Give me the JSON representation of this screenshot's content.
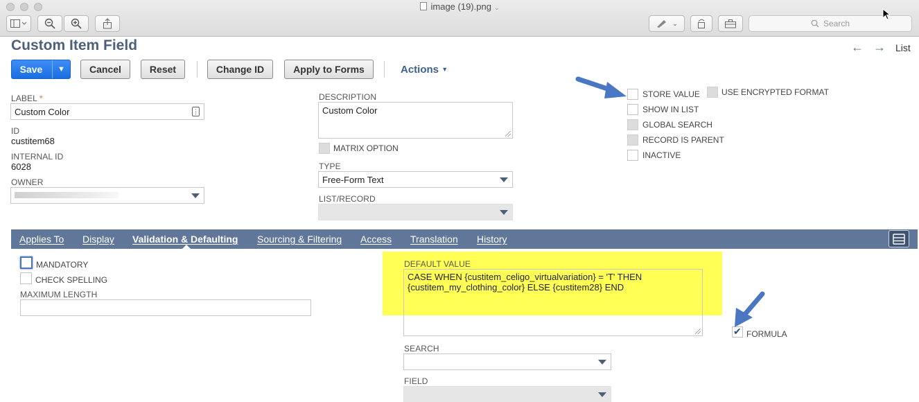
{
  "window": {
    "title": "image (19).png",
    "search_placeholder": "Search"
  },
  "page": {
    "title": "Custom Item Field",
    "nav": {
      "back_label": "←",
      "forward_label": "→",
      "list_label": "List"
    }
  },
  "buttons": {
    "save": "Save",
    "cancel": "Cancel",
    "reset": "Reset",
    "change_id": "Change ID",
    "apply_to_forms": "Apply to Forms",
    "actions": "Actions"
  },
  "fields": {
    "label": {
      "label": "LABEL",
      "required_mark": "*",
      "value": "Custom Color"
    },
    "id": {
      "label": "ID",
      "value": "custitem68"
    },
    "internal_id": {
      "label": "INTERNAL ID",
      "value": "6028"
    },
    "owner": {
      "label": "OWNER",
      "value": ""
    },
    "description": {
      "label": "DESCRIPTION",
      "value": "Custom Color"
    },
    "matrix_option": {
      "label": "MATRIX OPTION",
      "checked": false
    },
    "type": {
      "label": "TYPE",
      "value": "Free-Form Text"
    },
    "list_record": {
      "label": "LIST/RECORD",
      "value": ""
    }
  },
  "checkboxes_right": [
    {
      "label": "STORE VALUE",
      "checked": false
    },
    {
      "label": "USE ENCRYPTED FORMAT",
      "checked": false
    },
    {
      "label": "SHOW IN LIST",
      "checked": false
    },
    {
      "label": "GLOBAL SEARCH",
      "checked": false
    },
    {
      "label": "RECORD IS PARENT",
      "checked": false
    },
    {
      "label": "INACTIVE",
      "checked": false
    }
  ],
  "tabs": [
    {
      "label": "Applies To",
      "active": false
    },
    {
      "label": "Display",
      "active": false
    },
    {
      "label": "Validation & Defaulting",
      "active": true
    },
    {
      "label": "Sourcing & Filtering",
      "active": false
    },
    {
      "label": "Access",
      "active": false
    },
    {
      "label": "Translation",
      "active": false
    },
    {
      "label": "History",
      "active": false
    }
  ],
  "validation": {
    "mandatory": {
      "label": "MANDATORY",
      "checked": false
    },
    "check_spelling": {
      "label": "CHECK SPELLING",
      "checked": false
    },
    "maximum_length": {
      "label": "MAXIMUM LENGTH",
      "value": ""
    },
    "default_value": {
      "label": "DEFAULT VALUE",
      "value": "CASE WHEN {custitem_celigo_virtualvariation} = 'T' THEN {custitem_my_clothing_color} ELSE {custitem28} END"
    },
    "formula": {
      "label": "FORMULA",
      "checked": true
    },
    "search": {
      "label": "SEARCH",
      "value": ""
    },
    "field": {
      "label": "FIELD",
      "value": ""
    }
  },
  "colors": {
    "title": "#4d5f79",
    "primary_button": "#1a6ee0",
    "tabbar": "#607799",
    "highlight": "#ffff55",
    "annotation_arrow": "#4a77c4"
  }
}
